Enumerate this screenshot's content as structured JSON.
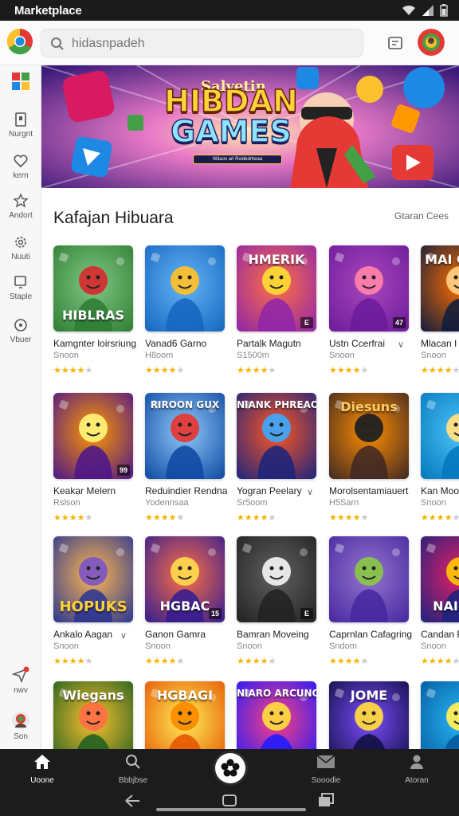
{
  "status_bar": {
    "app_title": "Marketplace"
  },
  "search": {
    "placeholder": "hidasnpadeh"
  },
  "rail": {
    "items": [
      {
        "label": "Nurgnt",
        "icon": "bookmark-icon"
      },
      {
        "label": "kern",
        "icon": "heart-icon"
      },
      {
        "label": "Andort",
        "icon": "star-icon"
      },
      {
        "label": "Nuuti",
        "icon": "gear-icon"
      },
      {
        "label": "Staple",
        "icon": "device-icon"
      },
      {
        "label": "Vbuer",
        "icon": "circle-icon"
      },
      {
        "label": "nwv",
        "icon": "send-icon"
      },
      {
        "label": "Son",
        "icon": "avatar-icon"
      }
    ]
  },
  "banner": {
    "subtitle": "Salvetin",
    "title_line1": "HIBDAN",
    "title_line2": "GAMES",
    "tagline": "Wiiaon arl Rvidedrheaa"
  },
  "section": {
    "title": "Kafajan Hibuara",
    "see_all": "Gtaran Cees"
  },
  "cards": [
    {
      "name": "Kamgnter loirsriung",
      "sub": "Snoon",
      "rating": 4,
      "overlay": "HIBLRAS",
      "badge": ""
    },
    {
      "name": "Vanad6 Garno",
      "sub": "H8oom",
      "rating": 4,
      "overlay": "",
      "badge": ""
    },
    {
      "name": "Partalk Magutn",
      "sub": "S1500m",
      "rating": 4,
      "overlay": "HMERIK",
      "badge": "E"
    },
    {
      "name": "Ustn Ccerfrai",
      "sub": "Snoon",
      "rating": 4,
      "overlay": "",
      "badge": "47"
    },
    {
      "name": "Mlacan I",
      "sub": "Snoon",
      "rating": 4,
      "overlay": "MAI CHAR",
      "badge": ""
    },
    {
      "name": "Keakar Melern",
      "sub": "Rslson",
      "rating": 4,
      "overlay": "",
      "badge": "99"
    },
    {
      "name": "Reduindier Rendna",
      "sub": "Yodennsaa",
      "rating": 4,
      "overlay": "RIROON GUX",
      "badge": ""
    },
    {
      "name": "Yogran Peelary",
      "sub": "Sr5oom",
      "rating": 4,
      "overlay": "NIANK PHREAOT",
      "badge": ""
    },
    {
      "name": "Morolsentamiauert",
      "sub": "H5Sarn",
      "rating": 4,
      "overlay": "Diesuns",
      "badge": ""
    },
    {
      "name": "Kan Moo",
      "sub": "Snoon",
      "rating": 4,
      "overlay": "",
      "badge": ""
    },
    {
      "name": "Ankalo Aagan",
      "sub": "Snoon",
      "rating": 4,
      "overlay": "HOPUKS",
      "badge": ""
    },
    {
      "name": "Ganon Gamra",
      "sub": "Snoon",
      "rating": 4,
      "overlay": "HGBAC",
      "badge": "15"
    },
    {
      "name": "Bamran Moveing",
      "sub": "Snoon",
      "rating": 4,
      "overlay": "",
      "badge": "E"
    },
    {
      "name": "Caprnlan Cafagring",
      "sub": "Sndom",
      "rating": 4,
      "overlay": "",
      "badge": ""
    },
    {
      "name": "Candan P",
      "sub": "Snoon",
      "rating": 4,
      "overlay": "NAI GIN",
      "badge": ""
    },
    {
      "name": "",
      "sub": "",
      "rating": 0,
      "overlay": "Wiegans",
      "badge": ""
    },
    {
      "name": "",
      "sub": "",
      "rating": 0,
      "overlay": "HGBAGI",
      "badge": ""
    },
    {
      "name": "",
      "sub": "",
      "rating": 0,
      "overlay": "NIARO ARCUNOS",
      "badge": ""
    },
    {
      "name": "",
      "sub": "",
      "rating": 0,
      "overlay": "JOME",
      "badge": ""
    },
    {
      "name": "",
      "sub": "",
      "rating": 0,
      "overlay": "",
      "badge": ""
    }
  ],
  "bottom_nav": {
    "items": [
      {
        "label": "Uoone",
        "icon": "home-icon",
        "active": true
      },
      {
        "label": "Bbbjbse",
        "icon": "search-icon",
        "active": false
      },
      {
        "label": "Sooodie",
        "icon": "mail-icon",
        "active": false
      },
      {
        "label": "Atoran",
        "icon": "person-icon",
        "active": false
      }
    ]
  },
  "colors": {
    "accent": "#f2b400",
    "nav_bg": "#1c1c1c",
    "status_bg": "#1b1b1b"
  }
}
